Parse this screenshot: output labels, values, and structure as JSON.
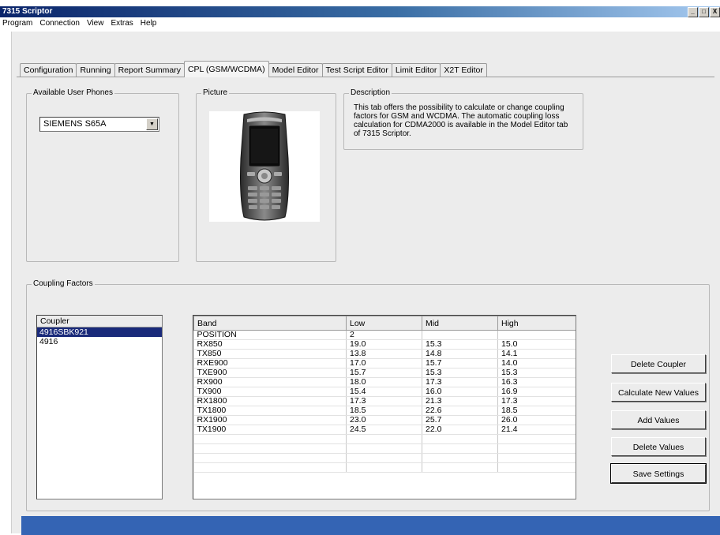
{
  "window": {
    "title": "7315 Scriptor",
    "controls": [
      "_",
      "□",
      "X"
    ]
  },
  "menu": [
    "Program",
    "Connection",
    "View",
    "Extras",
    "Help"
  ],
  "tabs": [
    {
      "label": "Configuration",
      "active": false
    },
    {
      "label": "Running",
      "active": false
    },
    {
      "label": "Report Summary",
      "active": false
    },
    {
      "label": "CPL (GSM/WCDMA)",
      "active": true
    },
    {
      "label": "Model Editor",
      "active": false
    },
    {
      "label": "Test Script Editor",
      "active": false
    },
    {
      "label": "Limit Editor",
      "active": false
    },
    {
      "label": "X2T Editor",
      "active": false
    }
  ],
  "phones": {
    "label": "Available User Phones",
    "selected": "SIEMENS S65A"
  },
  "picture": {
    "label": "Picture"
  },
  "description": {
    "label": "Description",
    "text": "This tab offers the possibility to calculate or change coupling factors for GSM and WCDMA. The automatic coupling loss calculation for CDMA2000 is available in the Model Editor tab of 7315 Scriptor."
  },
  "coupling": {
    "label": "Coupling Factors",
    "coupler_header": "Coupler",
    "couplers": [
      {
        "name": "4916SBK921",
        "selected": true
      },
      {
        "name": "4916",
        "selected": false
      }
    ],
    "columns": [
      "Band",
      "Low",
      "Mid",
      "High"
    ],
    "rows": [
      [
        "POSITION",
        "2",
        "",
        ""
      ],
      [
        "RX850",
        "19.0",
        "15.3",
        "15.0"
      ],
      [
        "TX850",
        "13.8",
        "14.8",
        "14.1"
      ],
      [
        "RXE900",
        "17.0",
        "15.7",
        "14.0"
      ],
      [
        "TXE900",
        "15.7",
        "15.3",
        "15.3"
      ],
      [
        "RX900",
        "18.0",
        "17.3",
        "16.3"
      ],
      [
        "TX900",
        "15.4",
        "16.0",
        "16.9"
      ],
      [
        "RX1800",
        "17.3",
        "21.3",
        "17.3"
      ],
      [
        "TX1800",
        "18.5",
        "22.6",
        "18.5"
      ],
      [
        "RX1900",
        "23.0",
        "25.7",
        "26.0"
      ],
      [
        "TX1900",
        "24.5",
        "22.0",
        "21.4"
      ],
      [
        "",
        "",
        "",
        ""
      ],
      [
        "",
        "",
        "",
        ""
      ],
      [
        "",
        "",
        "",
        ""
      ],
      [
        "",
        "",
        "",
        ""
      ]
    ]
  },
  "buttons": {
    "delete_coupler": "Delete Coupler",
    "calculate_new_values": "Calculate New Values",
    "add_values": "Add Values",
    "delete_values": "Delete Values",
    "save_settings": "Save Settings"
  }
}
